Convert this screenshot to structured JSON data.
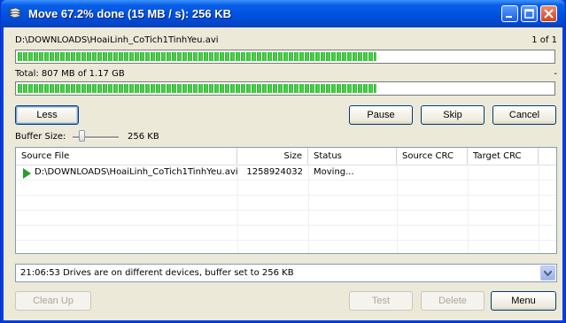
{
  "window": {
    "title": "Move 67.2% done (15 MB / s): 256 KB",
    "progress_file_fraction": 0.672,
    "progress_total_fraction": 0.672
  },
  "current_file": {
    "path": "D:\\DOWNLOADS\\HoaiLinh_CoTich1TinhYeu.avi",
    "counter": "1 of 1"
  },
  "total": {
    "label": "Total: 807 MB of 1.17 GB",
    "right": "-"
  },
  "buttons": {
    "less": "Less",
    "pause": "Pause",
    "skip": "Skip",
    "cancel": "Cancel",
    "clean_up": "Clean Up",
    "test": "Test",
    "delete": "Delete",
    "menu": "Menu"
  },
  "buffer": {
    "label": "Buffer Size:",
    "value": "256 KB"
  },
  "list": {
    "columns": [
      "Source File",
      "Size",
      "Status",
      "Source CRC",
      "Target CRC"
    ],
    "rows": [
      {
        "source": "D:\\DOWNLOADS\\HoaiLinh_CoTich1TinhYeu.avi",
        "size": "1258924032",
        "status": "Moving...",
        "source_crc": "",
        "target_crc": ""
      }
    ]
  },
  "status_bar": {
    "text": "21:06:53 Drives are on different devices, buffer set to 256 KB"
  },
  "colors": {
    "progress": "#2cb52c",
    "titlebar": "#0053e1",
    "row_arrow": "#2a9d2a"
  },
  "icons": [
    "move-app-icon",
    "minimize-icon",
    "maximize-icon",
    "close-icon",
    "play-arrow-icon",
    "chevron-down-icon"
  ]
}
